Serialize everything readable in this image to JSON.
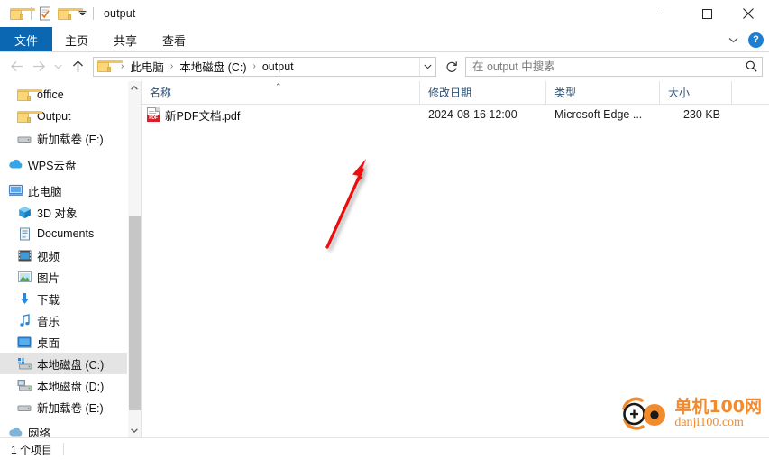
{
  "window": {
    "title": "output",
    "quick_access": [
      {
        "name": "folder-icon",
        "label": "folder"
      },
      {
        "name": "properties-icon",
        "label": "properties"
      },
      {
        "name": "new-folder-icon",
        "label": "new folder"
      },
      {
        "name": "customize-dropdown",
        "label": "customize"
      }
    ],
    "controls": {
      "minimize": "minimize",
      "maximize": "maximize",
      "close": "close"
    }
  },
  "ribbon": {
    "tabs": [
      {
        "label": "文件",
        "active": true
      },
      {
        "label": "主页",
        "active": false
      },
      {
        "label": "共享",
        "active": false
      },
      {
        "label": "查看",
        "active": false
      }
    ],
    "collapse_label": "collapse-ribbon",
    "help_label": "?"
  },
  "address": {
    "back": "back",
    "forward": "forward",
    "recent": "recent-locations",
    "up": "up",
    "breadcrumbs": [
      "此电脑",
      "本地磁盘 (C:)",
      "output"
    ],
    "separator": "›",
    "dropdown": "previous-locations",
    "refresh": "refresh"
  },
  "search": {
    "placeholder": "在 output 中搜索",
    "value": ""
  },
  "sidebar": {
    "items": [
      {
        "label": "office",
        "icon": "folder-icon",
        "indent": 1,
        "selected": false
      },
      {
        "label": "Output",
        "icon": "folder-icon",
        "indent": 1,
        "selected": false
      },
      {
        "label": "新加载卷 (E:)",
        "icon": "drive-icon",
        "indent": 1,
        "selected": false
      },
      {
        "label": "WPS云盘",
        "icon": "cloud-icon",
        "indent": 0,
        "selected": false
      },
      {
        "label": "此电脑",
        "icon": "computer-icon",
        "indent": 0,
        "selected": false
      },
      {
        "label": "3D 对象",
        "icon": "3d-objects-icon",
        "indent": 1,
        "selected": false
      },
      {
        "label": "Documents",
        "icon": "documents-icon",
        "indent": 1,
        "selected": false
      },
      {
        "label": "视频",
        "icon": "videos-icon",
        "indent": 1,
        "selected": false
      },
      {
        "label": "图片",
        "icon": "pictures-icon",
        "indent": 1,
        "selected": false
      },
      {
        "label": "下载",
        "icon": "downloads-icon",
        "indent": 1,
        "selected": false
      },
      {
        "label": "音乐",
        "icon": "music-icon",
        "indent": 1,
        "selected": false
      },
      {
        "label": "桌面",
        "icon": "desktop-icon",
        "indent": 1,
        "selected": false
      },
      {
        "label": "本地磁盘 (C:)",
        "icon": "local-disk-icon",
        "indent": 1,
        "selected": true
      },
      {
        "label": "本地磁盘 (D:)",
        "icon": "local-disk-icon",
        "indent": 1,
        "selected": false
      },
      {
        "label": "新加载卷 (E:)",
        "icon": "drive-icon",
        "indent": 1,
        "selected": false
      },
      {
        "label": "网络",
        "icon": "network-icon",
        "indent": 0,
        "selected": false
      }
    ],
    "scrollbar": {
      "up": "scroll-up",
      "down": "scroll-down"
    }
  },
  "file_list": {
    "columns": [
      {
        "label": "名称",
        "sorted": true,
        "sort_dir": "asc"
      },
      {
        "label": "修改日期",
        "sorted": false
      },
      {
        "label": "类型",
        "sorted": false
      },
      {
        "label": "大小",
        "sorted": false
      }
    ],
    "sort_glyph": "⌃",
    "rows": [
      {
        "name": "新PDF文档.pdf",
        "icon": "pdf-file-icon",
        "icon_text": "PDF",
        "date": "2024-08-16 12:00",
        "type": "Microsoft Edge ...",
        "size": "230 KB"
      }
    ]
  },
  "annotation": {
    "arrow_color": "#ee1111",
    "description": "red arrow pointing to pdf file"
  },
  "watermark": {
    "cn": "单机100网",
    "en": "danji100.com",
    "color": "#f28a2e"
  },
  "statusbar": {
    "item_count": "1 个项目"
  }
}
